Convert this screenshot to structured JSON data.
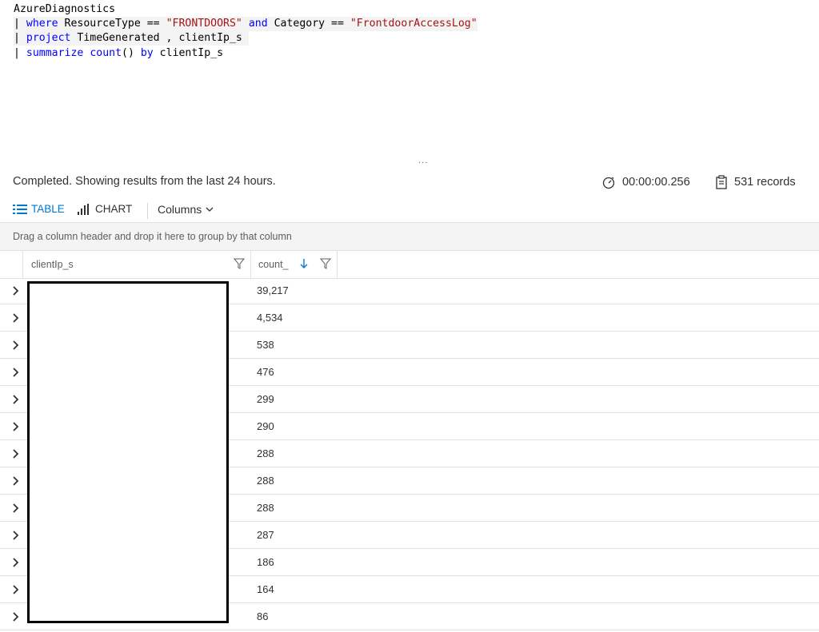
{
  "query": {
    "lines": [
      {
        "segments": [
          {
            "t": "AzureDiagnostics",
            "c": "plain"
          }
        ]
      },
      {
        "segments": [
          {
            "t": "| ",
            "c": "plain"
          },
          {
            "t": "where",
            "c": "kw"
          },
          {
            "t": " ResourceType == ",
            "c": "plain"
          },
          {
            "t": "\"FRONTDOORS\"",
            "c": "str"
          },
          {
            "t": " ",
            "c": "plain"
          },
          {
            "t": "and",
            "c": "kw"
          },
          {
            "t": " Category == ",
            "c": "plain"
          },
          {
            "t": "\"FrontdoorAccessLog\"",
            "c": "str"
          }
        ]
      },
      {
        "segments": [
          {
            "t": "| ",
            "c": "plain"
          },
          {
            "t": "project",
            "c": "kw"
          },
          {
            "t": " TimeGenerated , clientIp_s ",
            "c": "plain"
          }
        ]
      },
      {
        "segments": [
          {
            "t": "| ",
            "c": "plain"
          },
          {
            "t": "summarize",
            "c": "kw"
          },
          {
            "t": " ",
            "c": "plain"
          },
          {
            "t": "count",
            "c": "kw"
          },
          {
            "t": "() ",
            "c": "plain"
          },
          {
            "t": "by",
            "c": "kw"
          },
          {
            "t": " clientIp_s",
            "c": "plain"
          }
        ]
      }
    ]
  },
  "splitter_grip": "...",
  "status": {
    "message": "Completed. Showing results from the last 24 hours.",
    "duration": "00:00:00.256",
    "records": "531 records"
  },
  "toolbar": {
    "table_label": "TABLE",
    "chart_label": "CHART",
    "columns_label": "Columns"
  },
  "group_hint": "Drag a column header and drop it here to group by that column",
  "columns": [
    "clientIp_s",
    "count_"
  ],
  "rows": [
    {
      "count": "39,217"
    },
    {
      "count": "4,534"
    },
    {
      "count": "538"
    },
    {
      "count": "476"
    },
    {
      "count": "299"
    },
    {
      "count": "290"
    },
    {
      "count": "288"
    },
    {
      "count": "288"
    },
    {
      "count": "288"
    },
    {
      "count": "287"
    },
    {
      "count": "186"
    },
    {
      "count": "164"
    },
    {
      "count": "86"
    }
  ],
  "colors": {
    "accent": "#0078d4",
    "keyword": "#0000ff",
    "string": "#a31515"
  }
}
